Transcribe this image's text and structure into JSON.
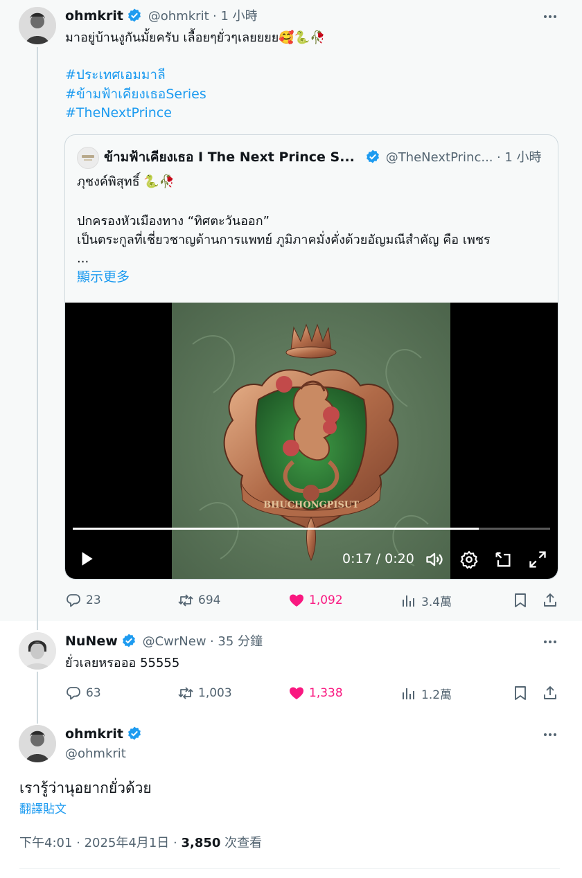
{
  "tweet1": {
    "name": "ohmkrit",
    "handle": "@ohmkrit",
    "time": "· 1 小時",
    "text": "มาอยู่บ้านงูกันมั้ยครับ เลื้อยๆยั่วๆเลยยยย🥰🐍🥀",
    "hashtags": [
      "#ประเทศเอมมาลี",
      "#ข้ามฟ้าเคียงเธอSeries",
      "#TheNextPrince"
    ],
    "quote": {
      "name": "ข้ามฟ้าเคียงเธอ I The Next Prince S...",
      "handle": "@TheNextPrinc...",
      "time": "· 1 小時",
      "line1": "ภุชงค์พิสุทธิ์ 🐍🥀",
      "line2": "ปกครองหัวเมืองทาง “ทิศตะวันออก”",
      "line3": "เป็นตระกูลที่เชี่ยวชาญด้านการแพทย์ ภูมิภาคมั่งคั่งด้วยอัญมณีสำคัญ คือ เพชร",
      "ellipsis": "...",
      "show_more": "顯示更多",
      "video_time": "0:17 / 0:20",
      "progress": 0.85,
      "banner_text": "BHUCHONGPISUT"
    },
    "stats": {
      "replies": "23",
      "retweets": "694",
      "likes": "1,092",
      "views": "3.4萬"
    }
  },
  "tweet2": {
    "name": "NuNew",
    "handle": "@CwrNew",
    "time": "· 35 分鐘",
    "text": "ยั่วเลยหรอออ 55555",
    "stats": {
      "replies": "63",
      "retweets": "1,003",
      "likes": "1,338",
      "views": "1.2萬"
    }
  },
  "tweet3": {
    "name": "ohmkrit",
    "handle": "@ohmkrit",
    "text": "เรารู้ว่านุอยากยั่วด้วย",
    "translate": "翻譯貼文",
    "time": "下午4:01 · 2025年4月1日 ·",
    "views_count": "3,850",
    "views_label": "次查看"
  },
  "colors": {
    "accent": "#1d9bf0",
    "like": "#f91880",
    "muted": "#536471",
    "verified": "#1d9bf0"
  },
  "icons": [
    "more-icon",
    "verified-icon",
    "reply-icon",
    "retweet-icon",
    "heart-icon",
    "views-icon",
    "bookmark-icon",
    "share-icon",
    "play-icon",
    "volume-icon",
    "settings-icon",
    "pip-icon",
    "fullscreen-icon"
  ]
}
